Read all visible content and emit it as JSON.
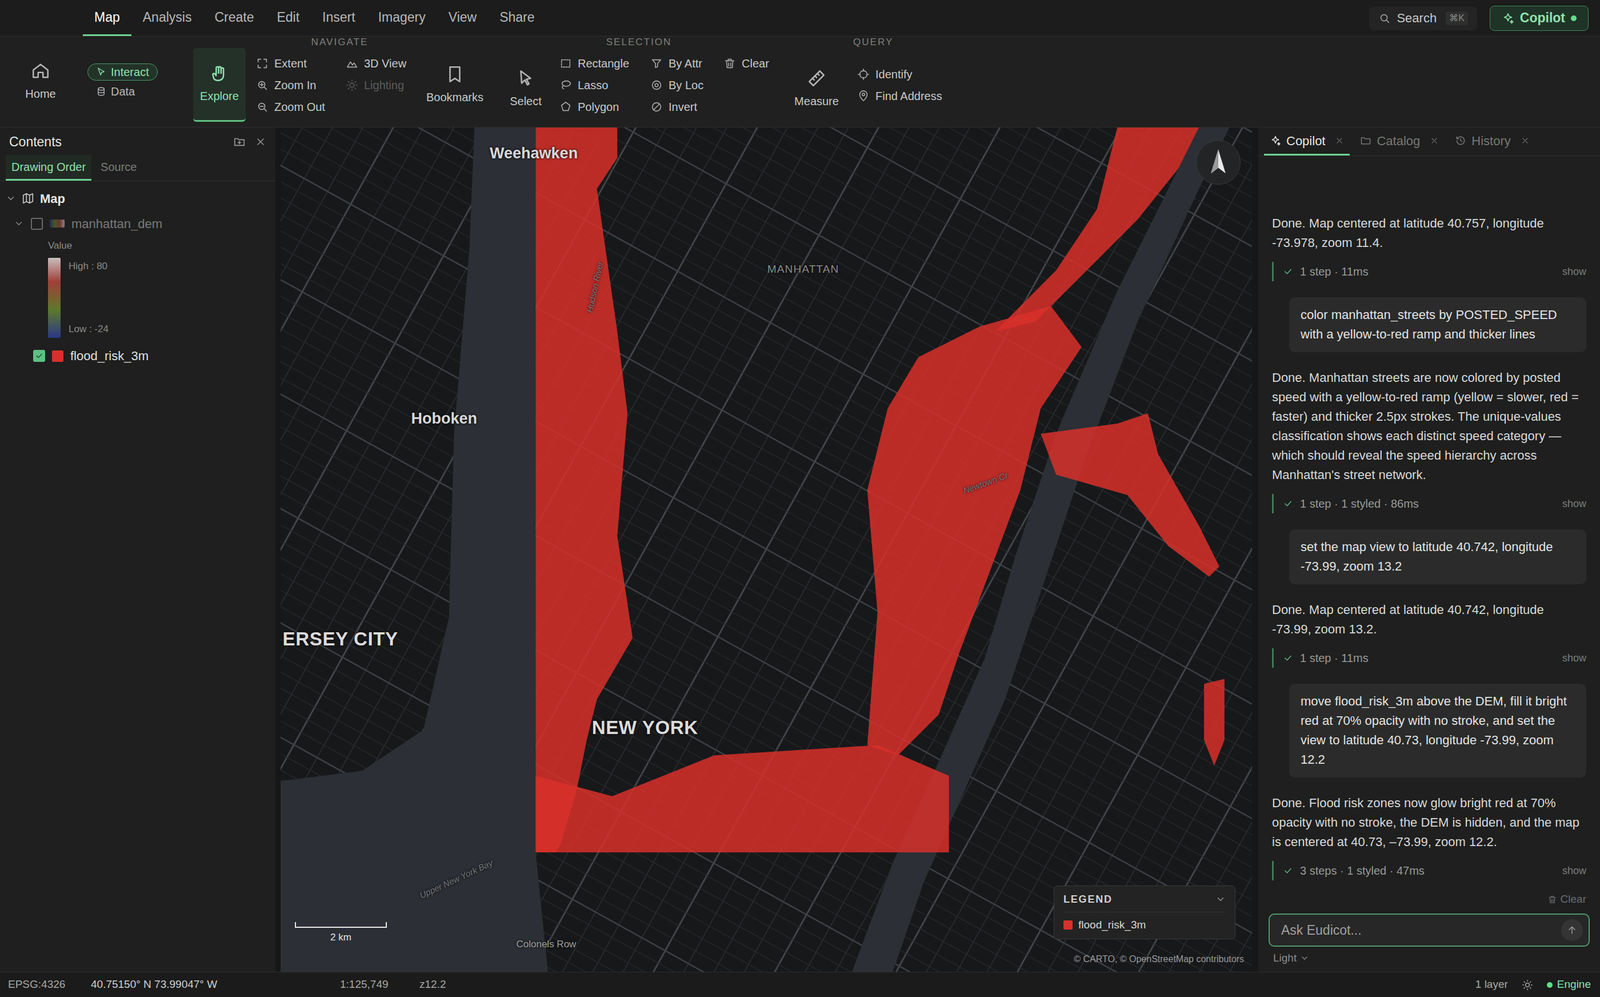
{
  "menu": {
    "tabs": [
      {
        "label": "Map",
        "selected": true
      },
      {
        "label": "Analysis",
        "selected": false
      },
      {
        "label": "Create",
        "selected": false
      },
      {
        "label": "Edit",
        "selected": false
      },
      {
        "label": "Insert",
        "selected": false
      },
      {
        "label": "Imagery",
        "selected": false
      },
      {
        "label": "View",
        "selected": false
      },
      {
        "label": "Share",
        "selected": false
      }
    ],
    "search": {
      "label": "Search",
      "shortcut": "⌘K"
    },
    "copilot": {
      "label": "Copilot",
      "on": true
    }
  },
  "ribbon": {
    "home": {
      "label": "Home"
    },
    "modes": [
      {
        "label": "Interact",
        "selected": true
      },
      {
        "label": "Data",
        "selected": false
      }
    ],
    "explore": {
      "label": "Explore",
      "selected": true
    },
    "navigate": {
      "title": "NAVIGATE",
      "columns": [
        [
          {
            "label": "Extent",
            "disabled": false
          },
          {
            "label": "Zoom In",
            "disabled": false
          },
          {
            "label": "Zoom Out",
            "disabled": false
          }
        ],
        [
          {
            "label": "3D View",
            "disabled": false
          },
          {
            "label": "Lighting",
            "disabled": true
          }
        ]
      ],
      "bookmarks": {
        "label": "Bookmarks"
      }
    },
    "select": {
      "label": "Select"
    },
    "selection": {
      "title": "SELECTION",
      "columns": [
        [
          {
            "label": "Rectangle"
          },
          {
            "label": "Lasso"
          },
          {
            "label": "Polygon"
          }
        ],
        [
          {
            "label": "By Attr"
          },
          {
            "label": "By Loc"
          },
          {
            "label": "Invert"
          }
        ],
        [
          {
            "label": "Clear"
          }
        ]
      ]
    },
    "measure": {
      "label": "Measure"
    },
    "query": {
      "title": "QUERY",
      "items": [
        {
          "label": "Identify"
        },
        {
          "label": "Find Address"
        }
      ]
    }
  },
  "contents": {
    "title": "Contents",
    "tabs": [
      {
        "label": "Drawing Order",
        "selected": true
      },
      {
        "label": "Source",
        "selected": false
      }
    ],
    "root": {
      "label": "Map",
      "expanded": true
    },
    "layers": [
      {
        "name": "manhattan_dem",
        "kind": "raster",
        "checked": false,
        "expanded": true,
        "legend": {
          "field": "Value",
          "high": "High : 80",
          "low": "Low : -24"
        }
      },
      {
        "name": "flood_risk_3m",
        "kind": "polygon",
        "checked": true,
        "color": "#d8302a"
      }
    ]
  },
  "map": {
    "labels": [
      {
        "text": "Weehawken",
        "kind": "town"
      },
      {
        "text": "MANHATTAN",
        "kind": "district"
      },
      {
        "text": "Hudson River",
        "kind": "water"
      },
      {
        "text": "Hoboken",
        "kind": "town"
      },
      {
        "text": "Newtown Cr",
        "kind": "water"
      },
      {
        "text": "ERSEY CITY",
        "kind": "city"
      },
      {
        "text": "NEW YORK",
        "kind": "city"
      },
      {
        "text": "Upper New York Bay",
        "kind": "water"
      },
      {
        "text": "Colonels Row",
        "kind": "street"
      }
    ],
    "scale": "2 km",
    "legend": {
      "title": "LEGEND",
      "expanded": true,
      "items": [
        {
          "label": "flood_risk_3m",
          "color": "#d8302a"
        }
      ]
    },
    "attribution": "© CARTO, © OpenStreetMap contributors"
  },
  "copilot": {
    "tabs": [
      {
        "label": "Copilot",
        "selected": true
      },
      {
        "label": "Catalog",
        "selected": false
      },
      {
        "label": "History",
        "selected": false
      }
    ],
    "messages": [
      {
        "kind": "assistant",
        "text": "Done. Map centered at latitude 40.757, longitude -73.978, zoom 11.4.",
        "steps": {
          "label": "1 step · 11ms",
          "action": "show",
          "ok": true
        }
      },
      {
        "kind": "user",
        "text": "color manhattan_streets by POSTED_SPEED with a yellow-to-red ramp and thicker lines"
      },
      {
        "kind": "assistant",
        "text": "Done. Manhattan streets are now colored by posted speed with a yellow-to-red ramp (yellow = slower, red = faster) and thicker 2.5px strokes. The unique-values classification shows each distinct speed category — which should reveal the speed hierarchy across Manhattan's street network.",
        "steps": {
          "label": "1 step · 1 styled · 86ms",
          "action": "show",
          "ok": true
        }
      },
      {
        "kind": "user",
        "text": "set the map view to latitude 40.742, longitude -73.99, zoom 13.2"
      },
      {
        "kind": "assistant",
        "text": "Done. Map centered at latitude 40.742, longitude -73.99, zoom 13.2.",
        "steps": {
          "label": "1 step · 11ms",
          "action": "show",
          "ok": true
        }
      },
      {
        "kind": "user",
        "text": "move flood_risk_3m above the DEM, fill it bright red at 70% opacity with no stroke, and set the view to latitude 40.73, longitude -73.99, zoom 12.2"
      },
      {
        "kind": "assistant",
        "text": "Done. Flood risk zones now glow bright red at 70% opacity with no stroke, the DEM is hidden, and the map is centered at 40.73, –73.99, zoom 12.2.",
        "steps": {
          "label": "3 steps · 1 styled · 47ms",
          "action": "show",
          "ok": true
        }
      }
    ],
    "clear": "Clear",
    "input": {
      "placeholder": "Ask Eudicot..."
    },
    "theme": {
      "label": "Light"
    }
  },
  "status": {
    "crs": "EPSG:4326",
    "coords": "40.75150° N 73.99047° W",
    "scale": "1:125,749",
    "zoom": "z12.2",
    "layers": "1 layer",
    "engine": {
      "label": "Engine",
      "on": true
    }
  }
}
